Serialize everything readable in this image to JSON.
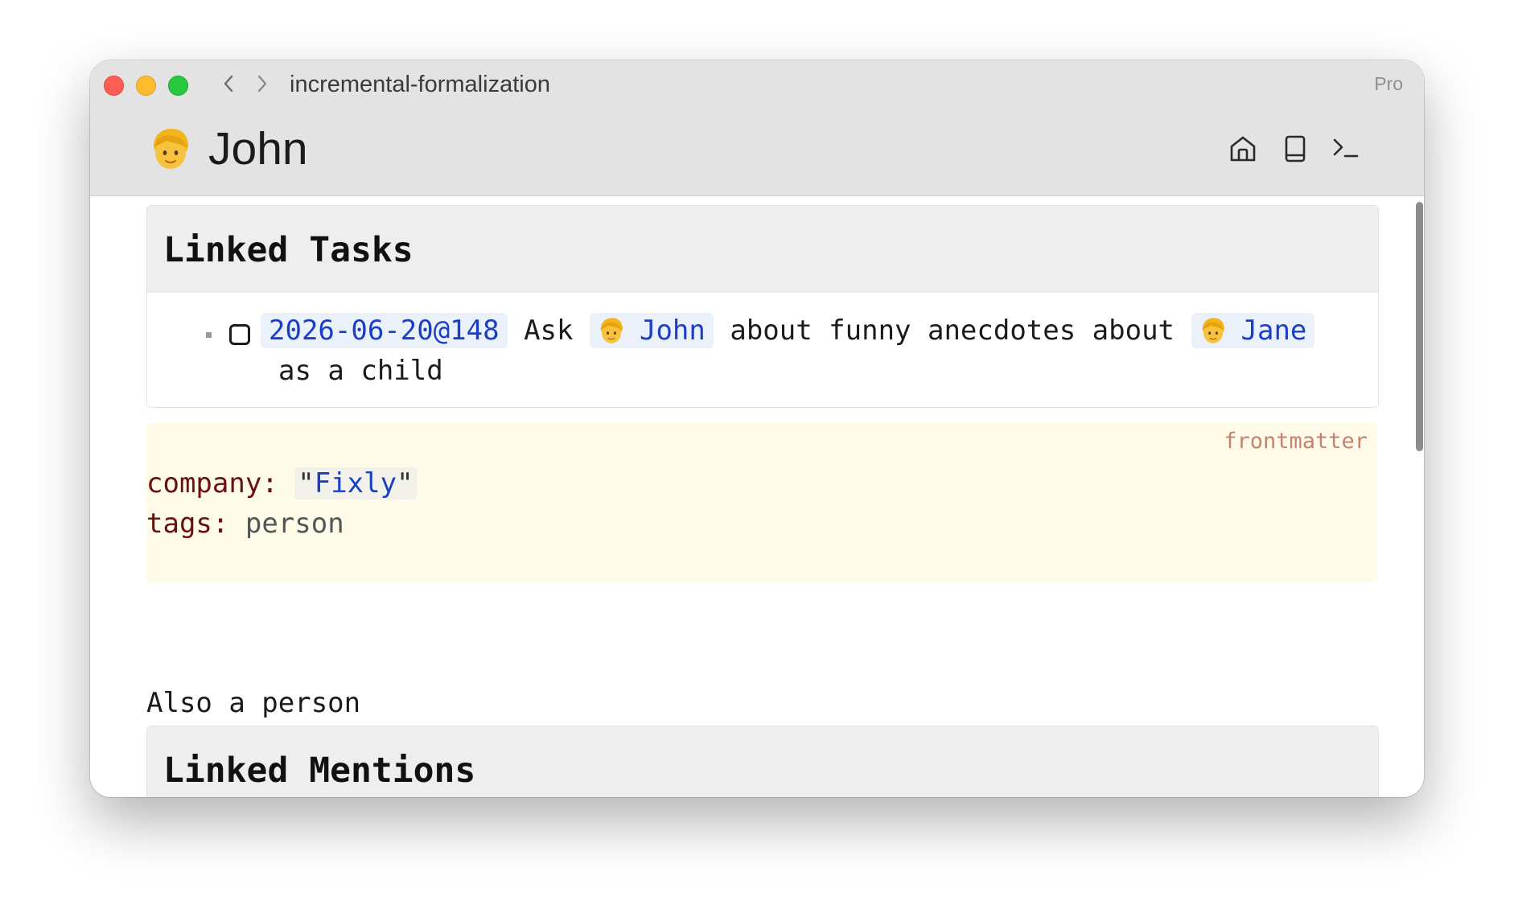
{
  "window": {
    "title": "incremental-formalization",
    "badge": "Pro"
  },
  "header": {
    "page_title": "John",
    "avatar_icon": "person-blond-emoji",
    "toolbar": [
      "home-icon",
      "book-icon",
      "terminal-icon"
    ]
  },
  "linked_tasks": {
    "title": "Linked Tasks",
    "tasks": [
      {
        "checked": false,
        "date_chip": "2026-06-20@148",
        "text_ask": "Ask",
        "mention1": "John",
        "text_middle": "about funny anecdotes about",
        "mention2": "Jane",
        "text_tail": "as a child"
      }
    ]
  },
  "frontmatter": {
    "label": "frontmatter",
    "company_key": "company:",
    "company_value": "Fixly",
    "tags_key": "tags:",
    "tags_value": "person"
  },
  "body": {
    "paragraph": "Also a person"
  },
  "linked_mentions": {
    "title": "Linked Mentions"
  },
  "colors": {
    "link": "#1a3fc7",
    "chip_bg": "#eaf1fb",
    "frontmatter_bg": "#fefbe9",
    "frontmatter_key": "#6b0f0f",
    "frontmatter_label": "#c4836f",
    "titlebar_bg": "#e3e3e3"
  }
}
